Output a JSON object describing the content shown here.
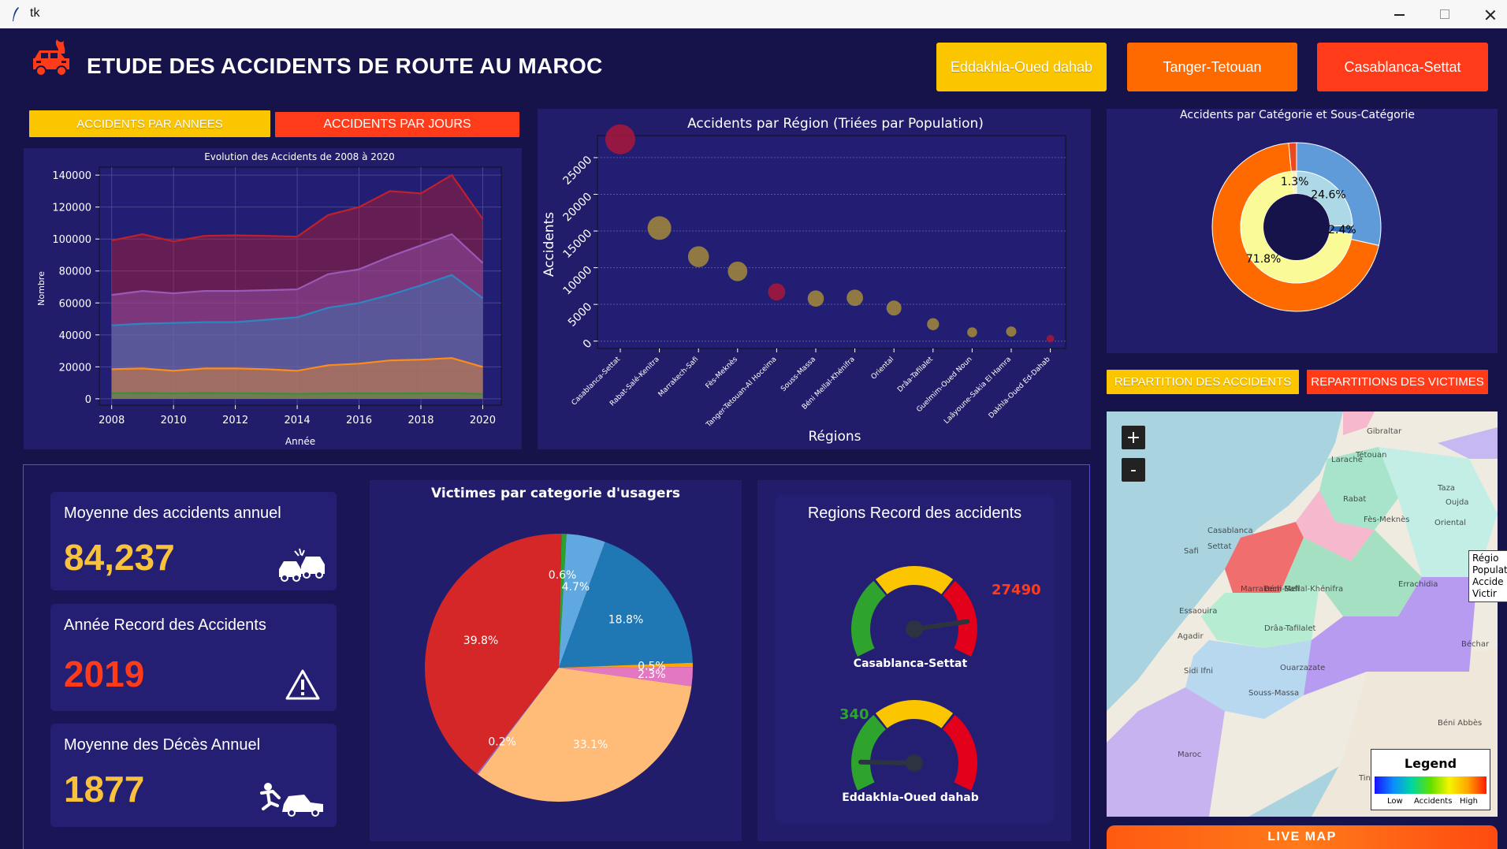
{
  "window": {
    "title": "tk"
  },
  "header": {
    "title": "ETUDE DES ACCIDENTS DE ROUTE AU MAROC"
  },
  "region_buttons": [
    "Eddakhla-Oued dahab",
    "Tanger-Tetouan",
    "Casablanca-Settat"
  ],
  "left_tabs": {
    "annees": "ACCIDENTS PAR ANNEES",
    "jours": "ACCIDENTS PAR JOURS"
  },
  "right_tabs": {
    "repartition": "REPARTITION DES ACCIDENTS",
    "victimes": "REPARTITIONS DES VICTIMES"
  },
  "colors": {
    "background": "#16124a",
    "panel": "#221d6b",
    "yellow": "#fbc500",
    "orange": "#ff6a00",
    "red": "#ff3b1a"
  },
  "kpis": [
    {
      "label": "Moyenne des accidents annuel",
      "value": "84,237",
      "color": "#f9c23c",
      "icon": "car-crash-icon"
    },
    {
      "label": "Année Record des Accidents",
      "value": "2019",
      "color": "#ff3b1a",
      "icon": "warning-icon"
    },
    {
      "label": "Moyenne des Décès Annuel",
      "value": "1877",
      "color": "#f9c23c",
      "icon": "pedestrian-accident-icon"
    }
  ],
  "gauges": {
    "title": "Regions Record des accidents",
    "items": [
      {
        "region": "Casablanca-Settat",
        "value": "27490",
        "level": 0.85,
        "color": "#ff3b1a"
      },
      {
        "region": "Eddakhla-Oued dahab",
        "value": "340",
        "level": 0.12,
        "color": "#2ea32e"
      }
    ]
  },
  "map": {
    "zoom_in": "+",
    "zoom_out": "-",
    "places": [
      "Gibraltar",
      "Tétouan",
      "Larache",
      "Rabat",
      "Casablanca",
      "Oujda",
      "Taza",
      "Fès-Meknès",
      "Oriental",
      "Settat",
      "Safi",
      "Marrakech-Safi",
      "Essaouira",
      "Errachidia",
      "Béni Mellal-Khénifra",
      "Drâa-Tafilalet",
      "Agadir",
      "Ouarzazate",
      "Sidi Ifni",
      "Souss-Massa",
      "Béchar",
      "Béni Abbès",
      "Maroc",
      "Tindouf"
    ],
    "popup": [
      "Régio",
      "Populati",
      "Accide",
      "Victir"
    ],
    "legend": {
      "title": "Legend",
      "low": "Low",
      "mid": "Accidents",
      "high": "High"
    },
    "live_button": "LIVE MAP"
  },
  "chart_data": [
    {
      "type": "area",
      "title": "Evolution des Accidents de 2008 à 2020",
      "xlabel": "Année",
      "ylabel": "Nombre",
      "x": [
        2008,
        2009,
        2010,
        2011,
        2012,
        2013,
        2014,
        2015,
        2016,
        2017,
        2018,
        2019,
        2020
      ],
      "xticks": [
        "2008",
        "2010",
        "2012",
        "2014",
        "2016",
        "2018",
        "2020"
      ],
      "yticks": [
        "0",
        "20000",
        "40000",
        "60000",
        "80000",
        "100000",
        "120000",
        "140000"
      ],
      "ylim": [
        -4000,
        145000
      ],
      "grid": true,
      "series": [
        {
          "color": "#c01f2c",
          "values": [
            99000,
            103000,
            98500,
            102000,
            102300,
            102000,
            101500,
            115000,
            120000,
            130000,
            128500,
            140000,
            112500
          ]
        },
        {
          "color": "#9b59b6",
          "values": [
            65000,
            67500,
            66000,
            67500,
            67500,
            68000,
            68500,
            78000,
            81000,
            89000,
            96000,
            103000,
            85000
          ]
        },
        {
          "color": "#2e86c1",
          "values": [
            46000,
            47000,
            47500,
            48000,
            48000,
            49500,
            51000,
            57000,
            60000,
            65000,
            71000,
            77500,
            63000
          ]
        },
        {
          "color": "#ff8c1a",
          "values": [
            18500,
            19000,
            17500,
            19000,
            19000,
            18500,
            17500,
            21000,
            22000,
            24000,
            24500,
            25500,
            20000
          ]
        },
        {
          "color": "#3a8f3a",
          "values": [
            3500,
            3600,
            3400,
            3600,
            3500,
            3300,
            3100,
            3300,
            3400,
            3300,
            3400,
            3500,
            3000
          ]
        }
      ]
    },
    {
      "type": "scatter",
      "title": "Accidents par Région (Triées par Population)",
      "xlabel": "Régions",
      "ylabel": "Accidents",
      "categories": [
        "Casablanca-Settat",
        "Rabat-Salé-Kenitra",
        "Marrakech-Safi",
        "Fès-Meknès",
        "Tanger-Tetouan-Al Hoceima",
        "Souss-Massa",
        "Béni Mellal-Khénifra",
        "Oriental",
        "Drâa-Tafilalet",
        "Guelmim-Oued Noun",
        "Laâyoune-Sakia El Hamra",
        "Dakhla-Oued Ed-Dahab"
      ],
      "values": [
        27490,
        15400,
        11500,
        9500,
        6700,
        5800,
        5900,
        4500,
        2300,
        1200,
        1300,
        340
      ],
      "colors": [
        "#a8183a",
        "#a38a3a",
        "#a38a3a",
        "#a38a3a",
        "#a8183a",
        "#a38a3a",
        "#a38a3a",
        "#a38a3a",
        "#a38a3a",
        "#a38a3a",
        "#a38a3a",
        "#a8183a"
      ],
      "yticks": [
        "0",
        "5000",
        "10000",
        "15000",
        "20000",
        "25000"
      ],
      "ylim": [
        -1000,
        28000
      ],
      "grid": true
    },
    {
      "type": "pie",
      "title": "Accidents par Catégorie et Sous-Catégorie",
      "outer": [
        {
          "value": 28.5,
          "color": "#5f9bd9"
        },
        {
          "value": 70.0,
          "color": "#ff6a00"
        },
        {
          "value": 1.5,
          "color": "#e8491f"
        }
      ],
      "inner": [
        {
          "value": 24.6,
          "color": "#add8e6",
          "label": "24.6%"
        },
        {
          "value": 2.4,
          "color": "#2e6db5",
          "label": "2.4%"
        },
        {
          "value": 71.8,
          "color": "#fafa96",
          "label": "71.8%"
        },
        {
          "value": 1.3,
          "color": "#fff0c0",
          "label": "1.3%"
        }
      ]
    },
    {
      "type": "pie",
      "title": "Victimes par categorie d'usagers",
      "slices": [
        {
          "value": 0.6,
          "color": "#2ca02c",
          "label": "0.6%"
        },
        {
          "value": 4.7,
          "color": "#5fa8e0",
          "label": "4.7%"
        },
        {
          "value": 18.8,
          "color": "#1f77b4",
          "label": "18.8%"
        },
        {
          "value": 0.5,
          "color": "#ffa500",
          "label": "0.5%"
        },
        {
          "value": 2.3,
          "color": "#e377c2",
          "label": "2.3%"
        },
        {
          "value": 33.1,
          "color": "#ffbb78",
          "label": "33.1%"
        },
        {
          "value": 0.2,
          "color": "#9467bd",
          "label": "0.2%"
        },
        {
          "value": 39.8,
          "color": "#d62728",
          "label": "39.8%"
        }
      ]
    }
  ]
}
